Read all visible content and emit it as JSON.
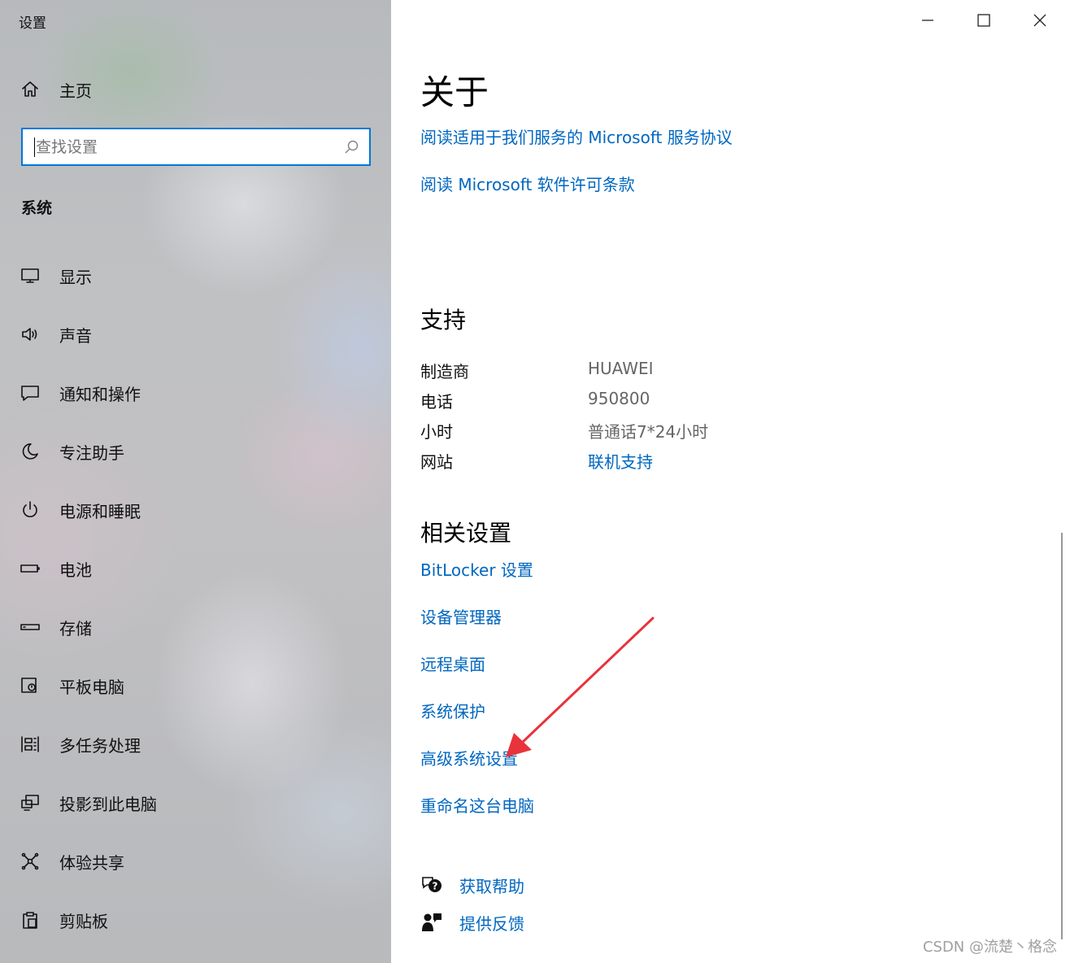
{
  "window": {
    "title": "设置",
    "controls": [
      "minimize",
      "maximize",
      "close"
    ]
  },
  "sidebar": {
    "home": {
      "label": "主页",
      "icon": "home-icon"
    },
    "search": {
      "placeholder": "查找设置",
      "value": "",
      "icon": "search-icon"
    },
    "section": "系统",
    "items": [
      {
        "label": "显示",
        "icon": "monitor-icon"
      },
      {
        "label": "声音",
        "icon": "speaker-icon"
      },
      {
        "label": "通知和操作",
        "icon": "notification-icon"
      },
      {
        "label": "专注助手",
        "icon": "moon-icon"
      },
      {
        "label": "电源和睡眠",
        "icon": "power-icon"
      },
      {
        "label": "电池",
        "icon": "battery-icon"
      },
      {
        "label": "存储",
        "icon": "storage-icon"
      },
      {
        "label": "平板电脑",
        "icon": "tablet-icon"
      },
      {
        "label": "多任务处理",
        "icon": "multitask-icon"
      },
      {
        "label": "投影到此电脑",
        "icon": "project-icon"
      },
      {
        "label": "体验共享",
        "icon": "share-icon"
      },
      {
        "label": "剪贴板",
        "icon": "clipboard-icon"
      }
    ]
  },
  "main": {
    "title": "关于",
    "links_top": [
      "阅读适用于我们服务的 Microsoft 服务协议",
      "阅读 Microsoft 软件许可条款"
    ],
    "support": {
      "heading": "支持",
      "rows": [
        {
          "key": "制造商",
          "value": "HUAWEI"
        },
        {
          "key": "电话",
          "value": "950800"
        },
        {
          "key": "小时",
          "value": "普通话7*24小时"
        },
        {
          "key": "网站",
          "link": "联机支持"
        }
      ]
    },
    "related": {
      "heading": "相关设置",
      "links": [
        "BitLocker 设置",
        "设备管理器",
        "远程桌面",
        "系统保护",
        "高级系统设置",
        "重命名这台电脑"
      ]
    },
    "help": [
      {
        "label": "获取帮助",
        "icon": "help-chat-icon"
      },
      {
        "label": "提供反馈",
        "icon": "feedback-icon"
      }
    ]
  },
  "watermark": "CSDN @流楚丶格念",
  "colors": {
    "accent": "#0078d7",
    "link": "#0067c0",
    "annotation_arrow": "#e8333a"
  }
}
